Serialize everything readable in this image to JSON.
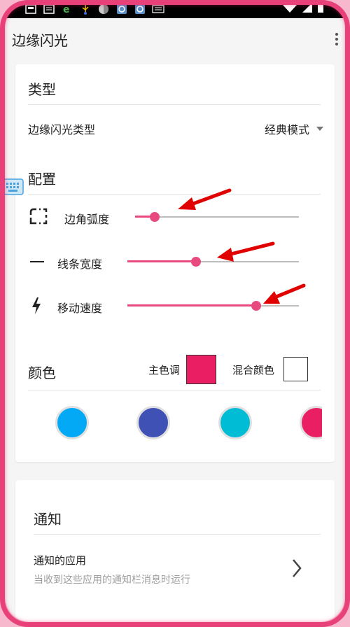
{
  "app": {
    "title": "边缘闪光"
  },
  "status_bar": {
    "left_icons": [
      "image-icon",
      "document-icon",
      "browser-icon",
      "usb-icon",
      "game-icon",
      "app-icon",
      "app-icon",
      "keyboard-icon"
    ],
    "right_icons": [
      "wifi-icon",
      "signal-icon",
      "battery-icon"
    ]
  },
  "type_section": {
    "title": "类型",
    "row_label": "边缘闪光类型",
    "selected_value": "经典模式"
  },
  "config_section": {
    "title": "配置",
    "sliders": [
      {
        "label": "边角弧度",
        "icon": "corner-radius-icon",
        "value": 0.12
      },
      {
        "label": "线条宽度",
        "icon": "line-width-icon",
        "value": 0.4
      },
      {
        "label": "移动速度",
        "icon": "flash-icon",
        "value": 0.75
      }
    ]
  },
  "color_section": {
    "title": "颜色",
    "primary_label": "主色调",
    "mix_label": "混合颜色",
    "primary_color": "#e91e63",
    "mix_color": "#ffffff",
    "palette": [
      "#03a9f4",
      "#3f51b5",
      "#00bcd4",
      "#e91e63"
    ]
  },
  "notify_section": {
    "title": "通知",
    "apps_title": "通知的应用",
    "apps_subtitle": "当收到这些应用的通知栏消息时运行"
  },
  "colors": {
    "accent": "#e84a7f",
    "edge_light": "#e8417a",
    "annotation_arrow": "#e00000"
  }
}
